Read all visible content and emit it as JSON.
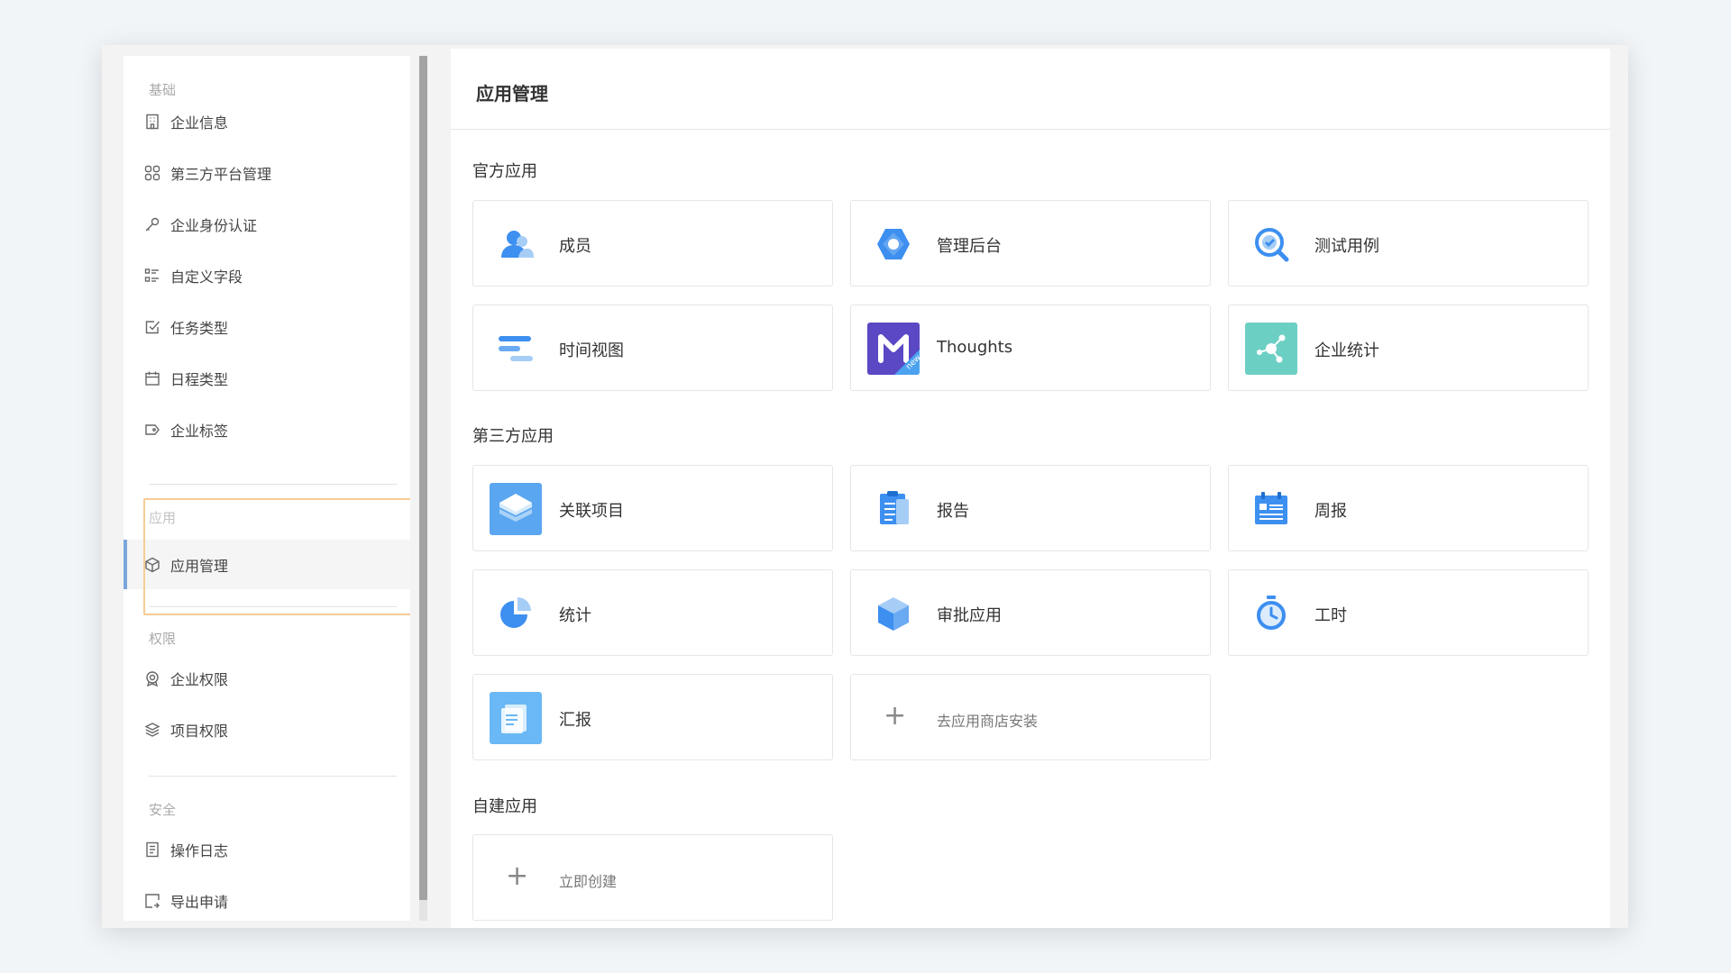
{
  "sidebar": {
    "sections": [
      {
        "title": "基础",
        "items": [
          {
            "label": "企业信息",
            "icon": "building-icon"
          },
          {
            "label": "第三方平台管理",
            "icon": "grid-icon"
          },
          {
            "label": "企业身份认证",
            "icon": "key-icon"
          },
          {
            "label": "自定义字段",
            "icon": "fields-list-icon"
          },
          {
            "label": "任务类型",
            "icon": "checkbox-icon"
          },
          {
            "label": "日程类型",
            "icon": "calendar-icon"
          },
          {
            "label": "企业标签",
            "icon": "tag-icon"
          }
        ]
      },
      {
        "title": "应用",
        "items": [
          {
            "label": "应用管理",
            "icon": "cube-icon",
            "active": true
          }
        ]
      },
      {
        "title": "权限",
        "items": [
          {
            "label": "企业权限",
            "icon": "badge-icon"
          },
          {
            "label": "项目权限",
            "icon": "layers-icon"
          }
        ]
      },
      {
        "title": "安全",
        "items": [
          {
            "label": "操作日志",
            "icon": "document-icon"
          },
          {
            "label": "导出申请",
            "icon": "export-icon"
          }
        ]
      }
    ]
  },
  "main": {
    "title": "应用管理",
    "groups": [
      {
        "title": "官方应用",
        "apps": [
          {
            "name": "成员",
            "icon": "members-icon"
          },
          {
            "name": "管理后台",
            "icon": "admin-hexagon-icon"
          },
          {
            "name": "测试用例",
            "icon": "test-search-icon"
          },
          {
            "name": "时间视图",
            "icon": "timeline-bars-icon"
          },
          {
            "name": "Thoughts",
            "icon": "thoughts-logo-icon",
            "badge": "new"
          },
          {
            "name": "企业统计",
            "icon": "network-stats-icon"
          }
        ]
      },
      {
        "title": "第三方应用",
        "apps": [
          {
            "name": "关联项目",
            "icon": "layers-stack-icon"
          },
          {
            "name": "报告",
            "icon": "clipboard-icon"
          },
          {
            "name": "周报",
            "icon": "weekly-report-icon"
          },
          {
            "name": "统计",
            "icon": "pie-chart-icon"
          },
          {
            "name": "审批应用",
            "icon": "approval-cube-icon"
          },
          {
            "name": "工时",
            "icon": "stopwatch-icon"
          },
          {
            "name": "汇报",
            "icon": "report-doc-icon"
          }
        ],
        "add": {
          "label": "去应用商店安装"
        }
      },
      {
        "title": "自建应用",
        "apps": [],
        "add": {
          "label": "立即创建"
        }
      }
    ]
  },
  "colors": {
    "accent": "#5aa6f0",
    "highlight_border": "#f6cc94",
    "active_bar": "#7aa7d9"
  }
}
